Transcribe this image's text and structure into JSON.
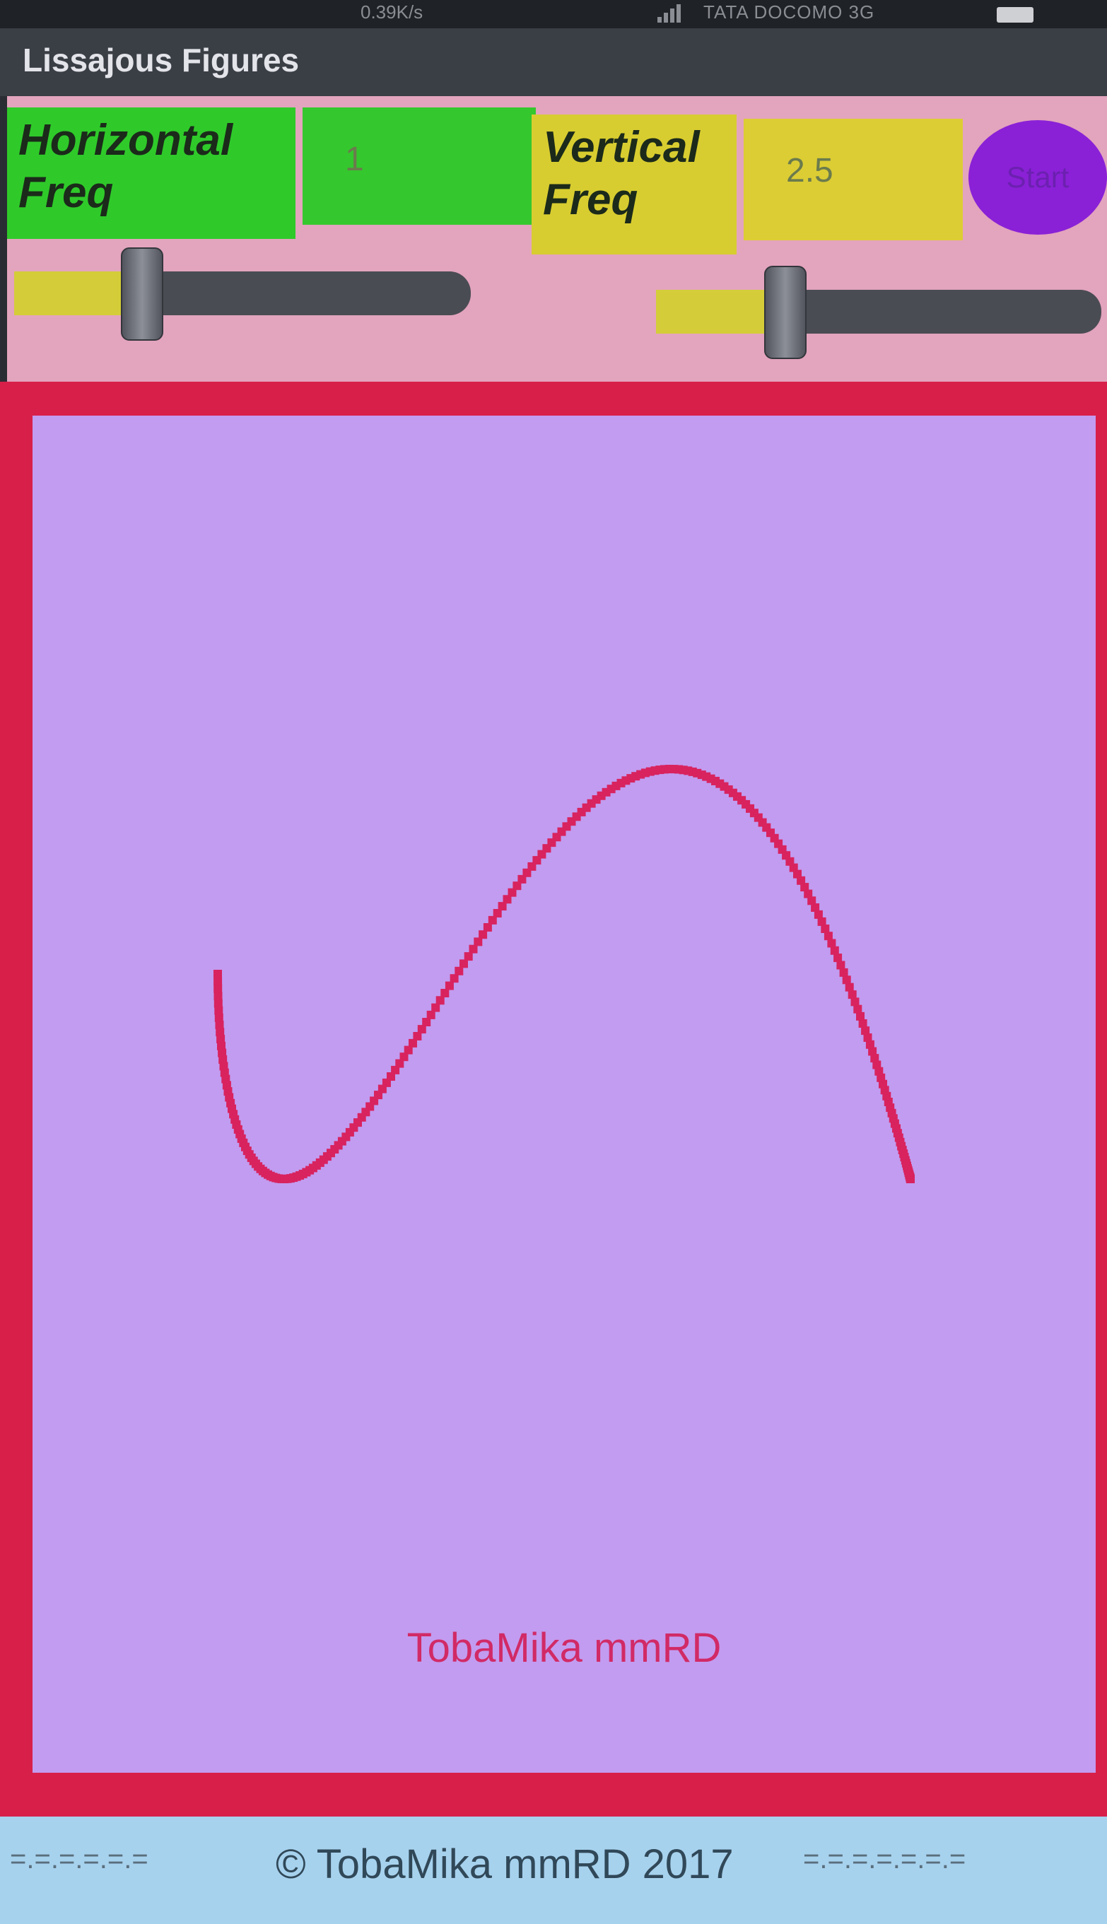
{
  "status_bar": {
    "speed": "0.39K/s",
    "carrier": "TATA DOCOMO 3G"
  },
  "app": {
    "title": "Lissajous Figures"
  },
  "controls": {
    "horizontal_label": "Horizontal Freq",
    "horizontal_value": "1",
    "vertical_label": "Vertical Freq",
    "vertical_value": "2.5",
    "start_label": "Start",
    "horizontal_slider_fraction": 0.28,
    "vertical_slider_fraction": 0.29
  },
  "canvas": {
    "credit": "TobaMika mmRD",
    "curve_color": "#d8235f",
    "background_color": "#c29cf0",
    "frame_color": "#d81f4a"
  },
  "footer": {
    "decoration_left": "=.=.=.=.=.=",
    "copyright": "© TobaMika mmRD 2017",
    "decoration_right": "=.=.=.=.=.=.="
  }
}
